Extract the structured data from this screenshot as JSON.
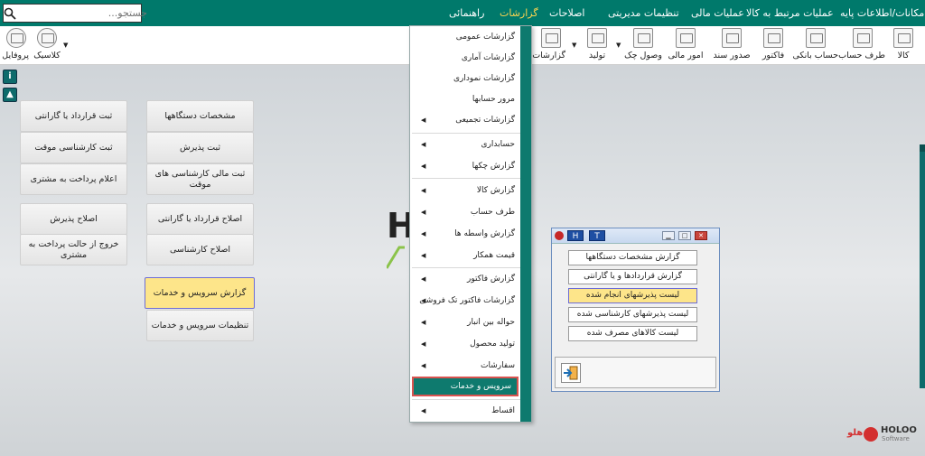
{
  "menubar": {
    "search_placeholder": "جستجو...",
    "items": [
      "امکانات/اطلاعات پایه",
      "عملیات مرتبط به کالا",
      "عملیات مالی",
      "تنظیمات مدیریتی",
      "اصلاحات",
      "گزارشات",
      "راهنمائی"
    ],
    "active_item": "گزارشات"
  },
  "toolbar": {
    "right_items": [
      "کالا",
      "طرف حساب",
      "حساب بانکی",
      "فاکتور",
      "صدور سند",
      "امور مالی",
      "وصول چک",
      "تولید",
      "گزارشات"
    ],
    "left_items": [
      "پروفایل",
      "کلاسیک"
    ]
  },
  "side_icons": [
    "info-icon",
    "image-icon"
  ],
  "background_logo": "H",
  "shortcuts": {
    "col_left": [
      "ثبت قرارداد یا گارانتی",
      "ثبت کارشناسی موقت",
      "اعلام پرداخت به مشتری",
      "اصلاح پذیرش",
      "خروج از حالت پرداخت به مشتری"
    ],
    "col_right": [
      "مشخصات دستگاهها",
      "ثبت پذیرش",
      "ثبت مالی کارشناسی های موقت",
      "اصلاح قرارداد یا گارانتی",
      "اصلاح کارشناسی",
      "گزارش سرویس و خدمات",
      "تنظیمات سرویس و خدمات"
    ],
    "highlighted": "گزارش سرویس و خدمات"
  },
  "dropdown": {
    "items": [
      {
        "label": "گزارشات عمومی",
        "submenu": false
      },
      {
        "label": "گزارشات آماری",
        "submenu": false
      },
      {
        "label": "گزارشات نموداری",
        "submenu": false
      },
      {
        "label": "مرور حسابها",
        "submenu": false
      },
      {
        "label": "گزارشات تجمیعی",
        "submenu": true
      },
      {
        "label": "حسابداری",
        "submenu": true
      },
      {
        "label": "گزارش چکها",
        "submenu": true
      },
      {
        "label": "گزارش کالا",
        "submenu": true
      },
      {
        "label": "طرف حساب",
        "submenu": true
      },
      {
        "label": "گزارش واسطه ها",
        "submenu": true
      },
      {
        "label": "قیمت همکار",
        "submenu": true
      },
      {
        "label": "گزارش فاکتور",
        "submenu": true
      },
      {
        "label": "گزارشات فاکتور تک فروشی",
        "submenu": true
      },
      {
        "label": "حواله بین انبار",
        "submenu": true
      },
      {
        "label": "تولید محصول",
        "submenu": true
      },
      {
        "label": "سفارشات",
        "submenu": true
      },
      {
        "label": "سرویس و خدمات",
        "submenu": false
      },
      {
        "label": "اقساط",
        "submenu": true
      }
    ],
    "selected": "سرویس و خدمات"
  },
  "dialog": {
    "tab_h": "H",
    "tab_t": "T",
    "buttons": [
      "گزارش مشخصات دستگاهها",
      "گزارش قراردادها و یا گارانتی",
      "لیست پذیرشهای انجام شده",
      "لیست پذیرشهای کارشناسی شده",
      "لیست کالاهای مصرف شده"
    ],
    "highlighted": "لیست پذیرشهای انجام شده"
  },
  "brand": {
    "fa": "هلو",
    "en": "HOLOO",
    "sub": "Software"
  },
  "colors": {
    "menubar": "#00796b",
    "highlight": "#fde58a",
    "accent_red": "#d32f2f"
  }
}
